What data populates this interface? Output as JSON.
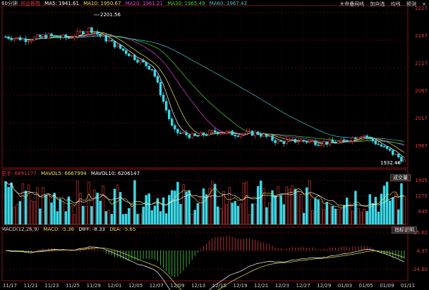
{
  "toolbar": {
    "items": [
      "大盘叠网线",
      "加自选",
      "均线",
      "预测"
    ],
    "close": "×"
  },
  "price_legend": {
    "period": "60分钟",
    "name": "创业板指",
    "ma5": "MA5: 1941.61",
    "ma10": "MA10: 1950.67",
    "ma20": "MA20: 1961.21",
    "ma30": "MA30: 1965.49",
    "ma60": "MA60: 1967.43"
  },
  "volume_legend": {
    "label": "总手: 6891177",
    "mavol5": "MAVOL5: 6667994",
    "mavol10": "MAVOL10: 6206147",
    "button": "成交量"
  },
  "macd_legend": {
    "label": "MACD(12,26,9)",
    "macd": "MACD: -5.36",
    "diff": "DIFF: -8.33",
    "dea": "DEA: -5.65",
    "button": "指标说明"
  },
  "annotations": {
    "high": "2201.56",
    "low": "1932.46"
  },
  "price_axis": [
    "2217",
    "2167",
    "2117",
    "2067",
    "2017",
    "1967"
  ],
  "volume_axis": [
    "1905",
    "1275",
    "645"
  ],
  "macd_axis": [
    "15.62",
    "4.37",
    "-24.80"
  ],
  "x_axis": [
    "11/17",
    "11/21",
    "11/23",
    "11/25",
    "11/29",
    "12/01",
    "12/05",
    "12/07",
    "12/09",
    "12/13",
    "12/15",
    "12/19",
    "12/21",
    "12/23",
    "12/27",
    "12/29",
    "01/03",
    "01/05",
    "01/09",
    "01/11"
  ],
  "colors": {
    "up": "#e03c3c",
    "down": "#3cd8e6",
    "ma5": "#ffffff",
    "ma10": "#e8e84b",
    "ma20": "#e040e0",
    "ma30": "#40d840",
    "ma60": "#40c8c8",
    "axis": "#a01818"
  },
  "chart_data": [
    {
      "type": "candlestick",
      "title": "",
      "series_points": {
        "name": "创业板指",
        "x": [
          "11/17",
          "11/21",
          "11/23",
          "11/25",
          "11/29",
          "12/01",
          "12/05",
          "12/07",
          "12/09",
          "12/13",
          "12/15",
          "12/19",
          "12/21",
          "12/23",
          "12/27",
          "12/29",
          "01/03",
          "01/05",
          "01/09",
          "01/11"
        ],
        "close": [
          2170,
          2165,
          2172,
          2168,
          2185,
          2160,
          2135,
          2110,
          1995,
          1985,
          1995,
          1990,
          1992,
          1975,
          1978,
          1974,
          1975,
          1990,
          1965,
          1941
        ]
      },
      "ylim": [
        1930,
        2225
      ],
      "high": 2201.56,
      "low": 1932.46
    },
    {
      "type": "bar",
      "title": "",
      "ylim": [
        0,
        1905
      ]
    },
    {
      "type": "bar",
      "title": "",
      "series": [
        {
          "name": "DIFF",
          "value": -8.33
        },
        {
          "name": "DEA",
          "value": -5.65
        },
        {
          "name": "MACD",
          "value": -5.36
        }
      ],
      "ylim": [
        -24.8,
        15.62
      ]
    }
  ]
}
